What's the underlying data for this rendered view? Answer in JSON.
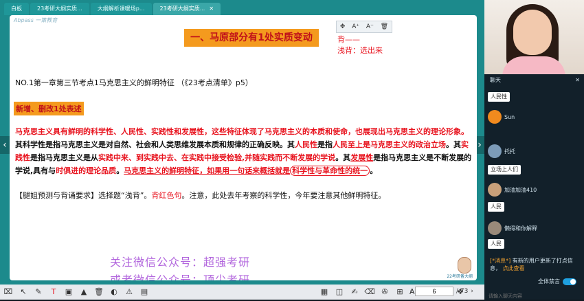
{
  "tabs": [
    {
      "label": "白板"
    },
    {
      "label": "23考研大纲实质..."
    },
    {
      "label": "大纲解析课暖场p..."
    },
    {
      "label": "23考研大纲实质..."
    }
  ],
  "slide": {
    "logo": "Abpass 一策教育",
    "title": "一、马原部分有1处实质变动",
    "edit_tools": [
      "✥",
      "A⁺",
      "A⁻",
      "🗑"
    ],
    "note_line1": "背——",
    "note_line2": "浅背：选出来",
    "section_line": "NO.1第一章第三节考点1马克思主义的鲜明特征 （《23考点清单》p5）",
    "tag": "新增、删改1处表述",
    "para": {
      "p1": "马克思主义具有鲜明的科学性、人民性、实践性和发展性，这些特征体现了马克思主义的本质和使命，也展现出马克思主义的理论形象。",
      "p2a": "其科学性是指马克思主义是对自然、社会和人类思维发展本质和规律的正确反映。其",
      "p2b": "人民性",
      "p2c": "是指",
      "p2d": "人民至上是马克思主义的政治立场",
      "p2e": "。其",
      "p2f": "实践性",
      "p2g": "是指马克思主义是从",
      "p2h": "实践中来、到实践中去、在实践中接受检验,并随实践而不断发展的学说",
      "p2i": "。其",
      "p2j": "发展性",
      "p2k": "是指马克思主义是不断发展的学说,具有与",
      "p2l": "时俱进的理论品质",
      "p2m": "。",
      "p2n": "马克思主义的鲜明特征，如果用一句话来概括就是",
      "p2o": "科学性与革命性的统一",
      "p2p": "。"
    },
    "line3a": "【腿姐预测与背诵要求】选择题“浅背”。",
    "line3b": "背红色句",
    "line3c": "。注意，此处去年考察的科学性，今年要注意其他鲜明特征。",
    "watermark1": "关注微信公众号：超强考研",
    "watermark2": "或者微信公众号：顶尖考研",
    "brand": "22考研备大纲"
  },
  "toolbar": {
    "tools": [
      "⌧",
      "↖",
      "✎",
      "T",
      "▣",
      "▲",
      "🗑",
      "◐",
      "⚠",
      "▤"
    ],
    "right_tools": [
      "▦",
      "◫",
      "✍",
      "⌫",
      "✇",
      "⊞",
      "AD",
      "≣",
      "⧉",
      "❖"
    ],
    "page_current": "6",
    "page_total": "/ 73"
  },
  "chat": {
    "header": "聊天",
    "close": "✕",
    "items": [
      {
        "kind": "pill",
        "text": "人民性"
      },
      {
        "kind": "msg",
        "name": "Sun",
        "color": "#f08a1e"
      },
      {
        "kind": "msg",
        "name": "托托",
        "color": "#7c9bb8"
      },
      {
        "kind": "pill",
        "text": "立场上人们"
      },
      {
        "kind": "msg",
        "name": "加油加油410",
        "color": "#c8a07a"
      },
      {
        "kind": "pill",
        "text": "人民"
      },
      {
        "kind": "msg",
        "name": "懒得和你解释",
        "color": "#9a8a7a"
      },
      {
        "kind": "pill",
        "text": "人民"
      }
    ],
    "system_prefix": "[*消息*]",
    "system_text": "有新的用户更新了打点信息，",
    "system_link": "点此查看",
    "mute_label": "全体禁言",
    "input_placeholder": "请输入聊天内容"
  }
}
